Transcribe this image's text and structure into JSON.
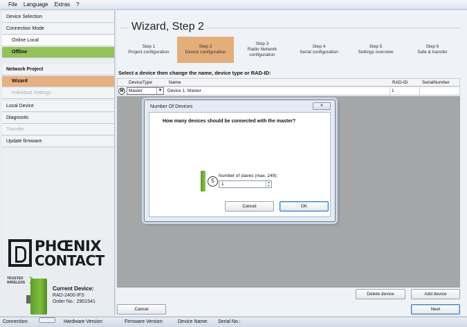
{
  "menu": [
    "File",
    "Language",
    "Extras",
    "?"
  ],
  "sidebar": {
    "items": [
      {
        "label": "Device Selection"
      },
      {
        "label": "Connection Mode"
      },
      {
        "label": "Online Local"
      },
      {
        "label": "Offline"
      },
      {
        "label": "Network Project"
      },
      {
        "label": "Wizard"
      },
      {
        "label": "Individual Settings"
      },
      {
        "label": "Local Device"
      },
      {
        "label": "Diagnostic"
      },
      {
        "label": "Transfer"
      },
      {
        "label": "Update firmware"
      }
    ],
    "logo_line1": "PHŒNIX",
    "logo_line2": "CONTACT",
    "trusted_line1": "TRUSTED",
    "trusted_line2": "WIRELESS",
    "current_device_title": "Current Device:",
    "current_device_model": "RAD-2400-IFS",
    "current_device_order": "Order No.: 2901541"
  },
  "main": {
    "title": "Wizard, Step 2",
    "steps": [
      {
        "line1": "Step 1",
        "line2": "Project configuration",
        "line3": ""
      },
      {
        "line1": "Step 2",
        "line2": "Device configuration",
        "line3": ""
      },
      {
        "line1": "Step 3",
        "line2": "Radio Network",
        "line3": "configuration"
      },
      {
        "line1": "Step 4",
        "line2": "Serial configuration",
        "line3": ""
      },
      {
        "line1": "Step 5",
        "line2": "Settings overview",
        "line3": ""
      },
      {
        "line1": "Step 6",
        "line2": "Safe & transfer",
        "line3": ""
      }
    ],
    "instruction": "Select a device then change the name, device type or RAD-ID:",
    "table": {
      "headers": {
        "devicetype": "DeviceType",
        "name": "Name",
        "radid": "RAD-ID",
        "serial": "SerialNumber"
      },
      "row": {
        "badge": "M",
        "devicetype": "Master",
        "name": "Device 1: Master",
        "radid": "1",
        "serial": ""
      }
    },
    "delete_button": "Delete device",
    "add_button": "Add device",
    "cancel_button": "Cancel",
    "next_button": "Next"
  },
  "dialog": {
    "title": "Number Of Devices",
    "question": "How many devices should be connected with the master?",
    "badge": "5",
    "field_label": "Number of slaves (max. 249):",
    "field_value": "1",
    "cancel": "Cancel",
    "ok": "OK"
  },
  "status": {
    "connection": "Connection:",
    "hardware": "Hardware Version:",
    "firmware": "Firmware Version:",
    "device_name": "Device Name:",
    "serial": "Serial No.:"
  }
}
